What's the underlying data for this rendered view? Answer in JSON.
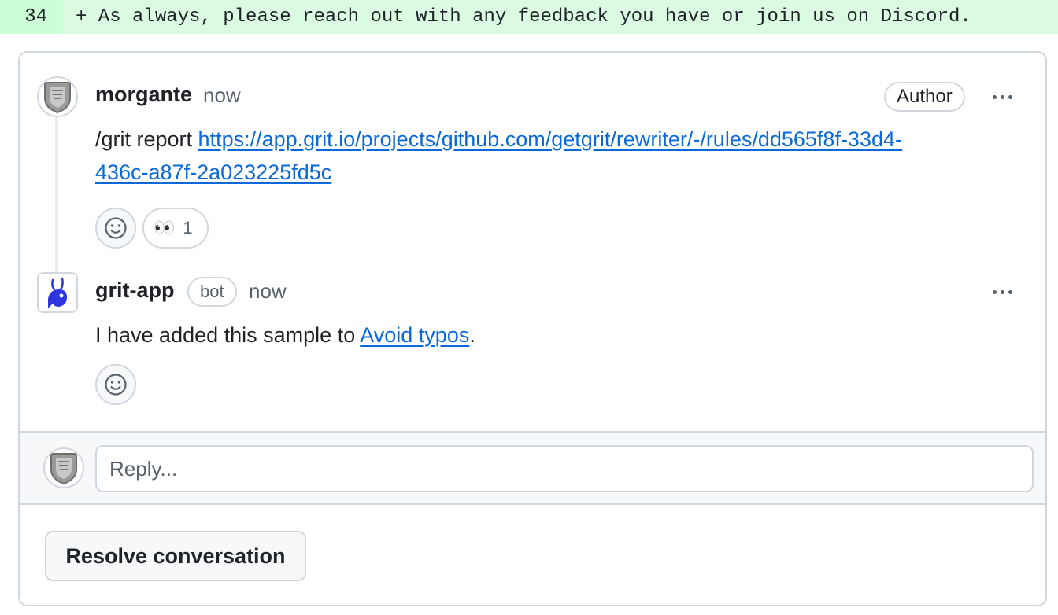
{
  "diff": {
    "line_number": "34",
    "code": "+ As always, please reach out with any feedback you have or join us on Discord."
  },
  "comments": [
    {
      "author": "morgante",
      "time": "now",
      "badge": "Author",
      "body_prefix": "/grit report ",
      "link_text_1": "https://app.grit.io/projects/github.com/getgrit/rewriter/-/rules/dd565f8f-33d4-",
      "link_text_2": "436c-a87f-2a023225fd5c",
      "reaction_emoji": "👀",
      "reaction_count": "1"
    },
    {
      "author": "grit-app",
      "badge": "bot",
      "time": "now",
      "body_prefix": "I have added this sample to ",
      "link_text": "Avoid typos",
      "body_suffix": "."
    }
  ],
  "reply": {
    "placeholder": "Reply..."
  },
  "resolve_label": "Resolve conversation",
  "colors": {
    "diff_bg": "#dafbe1",
    "link": "#0969da",
    "border": "#d0d7de",
    "bot_accent": "#2f36e0"
  }
}
